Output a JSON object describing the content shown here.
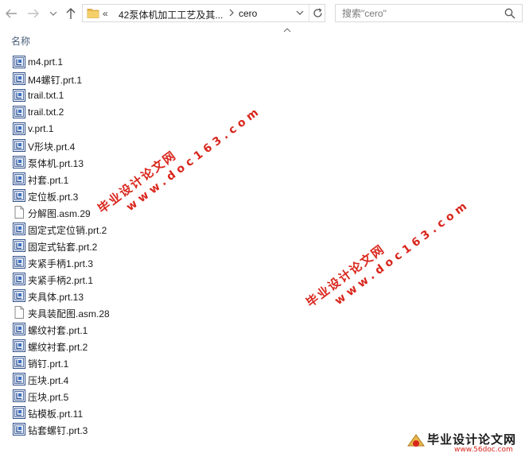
{
  "nav": {
    "address_overflow": "«",
    "address_segments": [
      "42泵体机加工工艺及其...",
      "cero"
    ],
    "search_placeholder": "搜索\"cero\""
  },
  "column": {
    "name": "名称"
  },
  "files": [
    {
      "name": "m4.prt.1",
      "icon": "part-icon"
    },
    {
      "name": "M4螺钉.prt.1",
      "icon": "part-icon"
    },
    {
      "name": "trail.txt.1",
      "icon": "part-icon"
    },
    {
      "name": "trail.txt.2",
      "icon": "part-icon"
    },
    {
      "name": "v.prt.1",
      "icon": "part-icon"
    },
    {
      "name": "V形块.prt.4",
      "icon": "part-icon"
    },
    {
      "name": "泵体机.prt.13",
      "icon": "part-icon"
    },
    {
      "name": "衬套.prt.1",
      "icon": "part-icon"
    },
    {
      "name": "定位板.prt.3",
      "icon": "part-icon"
    },
    {
      "name": "分解图.asm.29",
      "icon": "blank-file-icon"
    },
    {
      "name": "固定式定位销.prt.2",
      "icon": "part-icon"
    },
    {
      "name": "固定式钻套.prt.2",
      "icon": "part-icon"
    },
    {
      "name": "夹紧手柄1.prt.3",
      "icon": "part-icon"
    },
    {
      "name": "夹紧手柄2.prt.1",
      "icon": "part-icon"
    },
    {
      "name": "夹具体.prt.13",
      "icon": "part-icon"
    },
    {
      "name": "夹具装配图.asm.28",
      "icon": "blank-file-icon"
    },
    {
      "name": "螺纹衬套.prt.1",
      "icon": "part-icon"
    },
    {
      "name": "螺纹衬套.prt.2",
      "icon": "part-icon"
    },
    {
      "name": "销钉.prt.1",
      "icon": "part-icon"
    },
    {
      "name": "压块.prt.4",
      "icon": "part-icon"
    },
    {
      "name": "压块.prt.5",
      "icon": "part-icon"
    },
    {
      "name": "钻模板.prt.11",
      "icon": "part-icon"
    },
    {
      "name": "钻套螺钉.prt.3",
      "icon": "part-icon"
    }
  ],
  "watermark": {
    "title": "毕业设计论文网",
    "url": "www.doc163.com"
  },
  "logo": {
    "title": "毕业设计论文网",
    "url": "www.56doc.com"
  },
  "colors": {
    "watermark": "#d9261c",
    "header_text": "#4c607a",
    "folder": "#e8b84a"
  }
}
